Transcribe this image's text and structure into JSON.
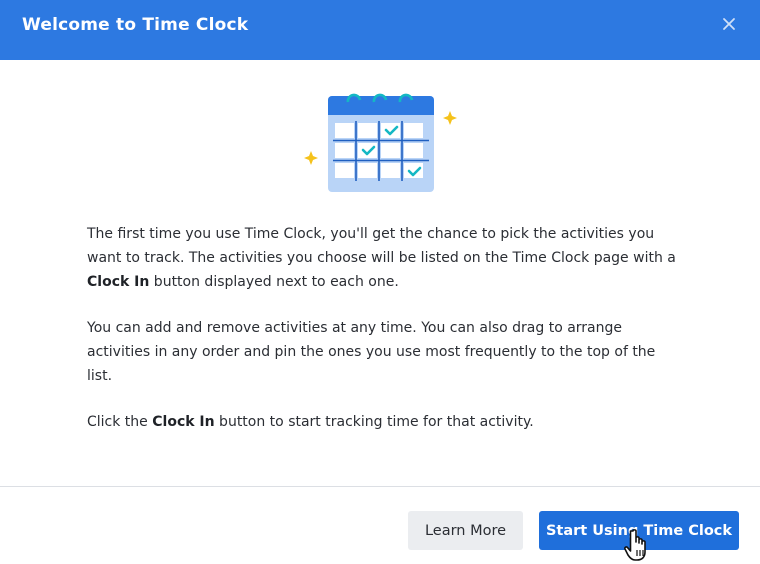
{
  "dialog": {
    "title": "Welcome to Time Clock",
    "close_icon": "close-icon"
  },
  "illustration": {
    "icon": "calendar-checkmarks-illustration",
    "sparkle_color": "#f5c21b",
    "calendar_color": "#2d79e1",
    "check_color": "#14b8c4"
  },
  "content": {
    "para1_part1": "The first time you use Time Clock, you'll get the chance to pick the activities you want to track. The activities you choose will be listed on the Time Clock page with a ",
    "para1_bold": "Clock In",
    "para1_part2": " button displayed next to each one.",
    "para2": "You can add and remove activities at any time. You can also drag to arrange activities in any order and pin the ones you use most frequently to the top of the list.",
    "para3_part1": "Click the ",
    "para3_bold": "Clock In",
    "para3_part2": " button to start tracking time for that activity."
  },
  "footer": {
    "learn_more_label": "Learn More",
    "start_label": "Start Using Time Clock"
  },
  "colors": {
    "header_bg": "#2d79e1",
    "primary_button": "#1f6fdb",
    "secondary_button": "#ebedf0"
  }
}
